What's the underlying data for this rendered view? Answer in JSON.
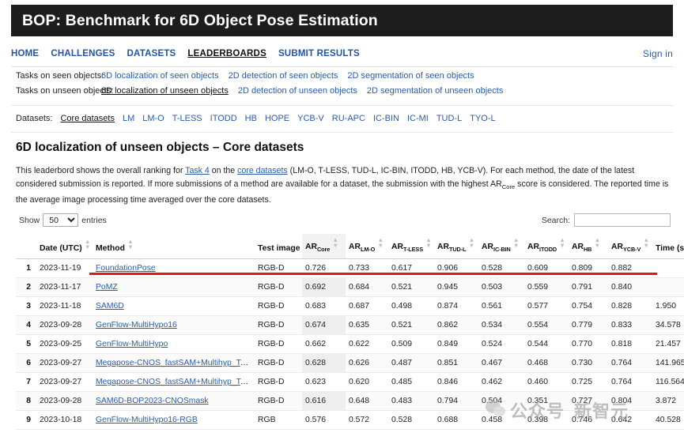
{
  "site": {
    "title": "BOP: Benchmark for 6D Object Pose Estimation"
  },
  "nav": {
    "items": [
      {
        "label": "HOME",
        "active": false
      },
      {
        "label": "CHALLENGES",
        "active": false
      },
      {
        "label": "DATASETS",
        "active": false
      },
      {
        "label": "LEADERBOARDS",
        "active": true
      },
      {
        "label": "SUBMIT RESULTS",
        "active": false
      }
    ],
    "sign_in": "Sign in"
  },
  "tasks": {
    "seen_label": "Tasks on seen objects:",
    "seen_items": [
      {
        "label": "6D localization of seen objects",
        "active": false
      },
      {
        "label": "2D detection of seen objects",
        "active": false
      },
      {
        "label": "2D segmentation of seen objects",
        "active": false
      }
    ],
    "unseen_label": "Tasks on unseen objects:",
    "unseen_items": [
      {
        "label": "6D localization of unseen objects",
        "active": true
      },
      {
        "label": "2D detection of unseen objects",
        "active": false
      },
      {
        "label": "2D segmentation of unseen objects",
        "active": false
      }
    ]
  },
  "datasets": {
    "label": "Datasets:",
    "items": [
      {
        "label": "Core datasets",
        "active": true
      },
      {
        "label": "LM",
        "active": false
      },
      {
        "label": "LM-O",
        "active": false
      },
      {
        "label": "T-LESS",
        "active": false
      },
      {
        "label": "ITODD",
        "active": false
      },
      {
        "label": "HB",
        "active": false
      },
      {
        "label": "HOPE",
        "active": false
      },
      {
        "label": "YCB-V",
        "active": false
      },
      {
        "label": "RU-APC",
        "active": false
      },
      {
        "label": "IC-BIN",
        "active": false
      },
      {
        "label": "IC-MI",
        "active": false
      },
      {
        "label": "TUD-L",
        "active": false
      },
      {
        "label": "TYO-L",
        "active": false
      }
    ]
  },
  "page": {
    "heading": "6D localization of unseen objects – Core datasets",
    "description_parts": {
      "p1": "This leaderbord shows the overall ranking for ",
      "link1": "Task 4",
      "p2": " on the ",
      "link2": "core datasets",
      "p3": " (LM-O, T-LESS, TUD-L, IC-BIN, ITODD, HB, YCB-V). For each method, the date of the latest considered submission is reported. If more submissions of a method are available for a dataset, the submission with the highest AR",
      "sub1": "Core",
      "p4": " score is considered. The reported time is the average image processing time averaged over the core datasets."
    }
  },
  "controls": {
    "show_label": "Show",
    "entries_label": "entries",
    "show_value": "50",
    "show_options": [
      "10",
      "25",
      "50",
      "100"
    ],
    "search_label": "Search:",
    "search_value": "",
    "search_placeholder": ""
  },
  "table": {
    "columns": [
      {
        "key": "rank",
        "label": "",
        "sub": "",
        "sortable": false,
        "sorted": false
      },
      {
        "key": "date",
        "label": "Date (UTC)",
        "sub": "",
        "sortable": true,
        "sorted": false
      },
      {
        "key": "method",
        "label": "Method",
        "sub": "",
        "sortable": true,
        "sorted": false
      },
      {
        "key": "image",
        "label": "Test image",
        "sub": "",
        "sortable": true,
        "sorted": false
      },
      {
        "key": "arcore",
        "label": "AR",
        "sub": "Core",
        "sortable": true,
        "sorted": true
      },
      {
        "key": "arlmo",
        "label": "AR",
        "sub": "LM-O",
        "sortable": true,
        "sorted": false
      },
      {
        "key": "artless",
        "label": "AR",
        "sub": "T-LESS",
        "sortable": true,
        "sorted": false
      },
      {
        "key": "artudl",
        "label": "AR",
        "sub": "TUD-L",
        "sortable": true,
        "sorted": false
      },
      {
        "key": "aricbin",
        "label": "AR",
        "sub": "IC-BIN",
        "sortable": true,
        "sorted": false
      },
      {
        "key": "aritodd",
        "label": "AR",
        "sub": "ITODD",
        "sortable": true,
        "sorted": false
      },
      {
        "key": "arhb",
        "label": "AR",
        "sub": "HB",
        "sortable": true,
        "sorted": false
      },
      {
        "key": "arycbv",
        "label": "AR",
        "sub": "YCB-V",
        "sortable": true,
        "sorted": false
      },
      {
        "key": "time",
        "label": "Time (s)",
        "sub": "",
        "sortable": true,
        "sorted": false
      }
    ],
    "rows": [
      {
        "rank": "1",
        "date": "2023-11-19",
        "method": "FoundationPose",
        "image": "RGB-D",
        "arcore": "0.726",
        "arlmo": "0.733",
        "artless": "0.617",
        "artudl": "0.906",
        "aricbin": "0.528",
        "aritodd": "0.609",
        "arhb": "0.809",
        "arycbv": "0.882",
        "time": ""
      },
      {
        "rank": "2",
        "date": "2023-11-17",
        "method": "PoMZ",
        "image": "RGB-D",
        "arcore": "0.692",
        "arlmo": "0.684",
        "artless": "0.521",
        "artudl": "0.945",
        "aricbin": "0.503",
        "aritodd": "0.559",
        "arhb": "0.791",
        "arycbv": "0.840",
        "time": ""
      },
      {
        "rank": "3",
        "date": "2023-11-18",
        "method": "SAM6D",
        "image": "RGB-D",
        "arcore": "0.683",
        "arlmo": "0.687",
        "artless": "0.498",
        "artudl": "0.874",
        "aricbin": "0.561",
        "aritodd": "0.577",
        "arhb": "0.754",
        "arycbv": "0.828",
        "time": "1.950"
      },
      {
        "rank": "4",
        "date": "2023-09-28",
        "method": "GenFlow-MultiHypo16",
        "image": "RGB-D",
        "arcore": "0.674",
        "arlmo": "0.635",
        "artless": "0.521",
        "artudl": "0.862",
        "aricbin": "0.534",
        "aritodd": "0.554",
        "arhb": "0.779",
        "arycbv": "0.833",
        "time": "34.578"
      },
      {
        "rank": "5",
        "date": "2023-09-25",
        "method": "GenFlow-MultiHypo",
        "image": "RGB-D",
        "arcore": "0.662",
        "arlmo": "0.622",
        "artless": "0.509",
        "artudl": "0.849",
        "aricbin": "0.524",
        "aritodd": "0.544",
        "arhb": "0.770",
        "arycbv": "0.818",
        "time": "21.457"
      },
      {
        "rank": "6",
        "date": "2023-09-27",
        "method": "Megapose-CNOS_fastSAM+Multihyp_Te…",
        "image": "RGB-D",
        "arcore": "0.628",
        "arlmo": "0.626",
        "artless": "0.487",
        "artudl": "0.851",
        "aricbin": "0.467",
        "aritodd": "0.468",
        "arhb": "0.730",
        "arycbv": "0.764",
        "time": "141.965"
      },
      {
        "rank": "7",
        "date": "2023-09-27",
        "method": "Megapose-CNOS_fastSAM+Multihyp_Te…",
        "image": "RGB-D",
        "arcore": "0.623",
        "arlmo": "0.620",
        "artless": "0.485",
        "artudl": "0.846",
        "aricbin": "0.462",
        "aritodd": "0.460",
        "arhb": "0.725",
        "arycbv": "0.764",
        "time": "116.564"
      },
      {
        "rank": "8",
        "date": "2023-09-28",
        "method": "SAM6D-BOP2023-CNOSmask",
        "image": "RGB-D",
        "arcore": "0.616",
        "arlmo": "0.648",
        "artless": "0.483",
        "artudl": "0.794",
        "aricbin": "0.504",
        "aritodd": "0.351",
        "arhb": "0.727",
        "arycbv": "0.804",
        "time": "3.872"
      },
      {
        "rank": "9",
        "date": "2023-10-18",
        "method": "GenFlow-MultiHypo16-RGB",
        "image": "RGB",
        "arcore": "0.576",
        "arlmo": "0.572",
        "artless": "0.528",
        "artudl": "0.688",
        "aricbin": "0.458",
        "aritodd": "0.398",
        "arhb": "0.746",
        "arycbv": "0.642",
        "time": "40.528"
      }
    ],
    "highlight_row_index": 0,
    "highlight_color": "#e8130c"
  },
  "watermark": {
    "text_left": "公众号",
    "text_right": "新智元",
    "icon": "wechat-icon"
  }
}
